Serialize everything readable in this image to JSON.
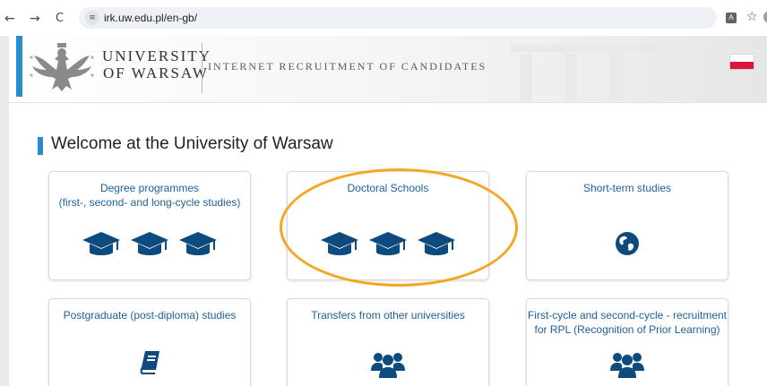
{
  "browser": {
    "back": "←",
    "forward": "→",
    "reload": "C",
    "url": "irk.uw.edu.pl/en-gb/",
    "site_info_icon": "tune-icon",
    "translate_icon": "translate-icon",
    "bookmark_icon": "star-icon"
  },
  "header": {
    "university_line1": "UNIVERSITY",
    "university_line2": "OF WARSAW",
    "system_name": "INTERNET RECRUITMENT OF CANDIDATES",
    "language_flag": "polish-flag"
  },
  "main": {
    "welcome": "Welcome at the University of Warsaw",
    "cards": [
      {
        "line1": "Degree programmes",
        "line2": "(first-, second- and long-cycle studies)",
        "icon": "graduation-cap-icon"
      },
      {
        "line1": "Doctoral Schools",
        "line2": "",
        "icon": "graduation-cap-icon"
      },
      {
        "line1": "Short-term studies",
        "line2": "",
        "icon": "globe-icon"
      },
      {
        "line1": "Postgraduate (post-diploma) studies",
        "line2": "",
        "icon": "book-icon"
      },
      {
        "line1": "Transfers from other universities",
        "line2": "",
        "icon": "users-icon"
      },
      {
        "line1": "First-cycle and second-cycle - recruitment",
        "line2": "for RPL (Recognition of Prior Learning)",
        "icon": "users-icon"
      }
    ]
  },
  "colors": {
    "accent": "#2a8ccf",
    "link": "#1e5f9a",
    "icon": "#0d4a7e",
    "highlight": "#f5a623",
    "flag_red": "#dc143c"
  }
}
